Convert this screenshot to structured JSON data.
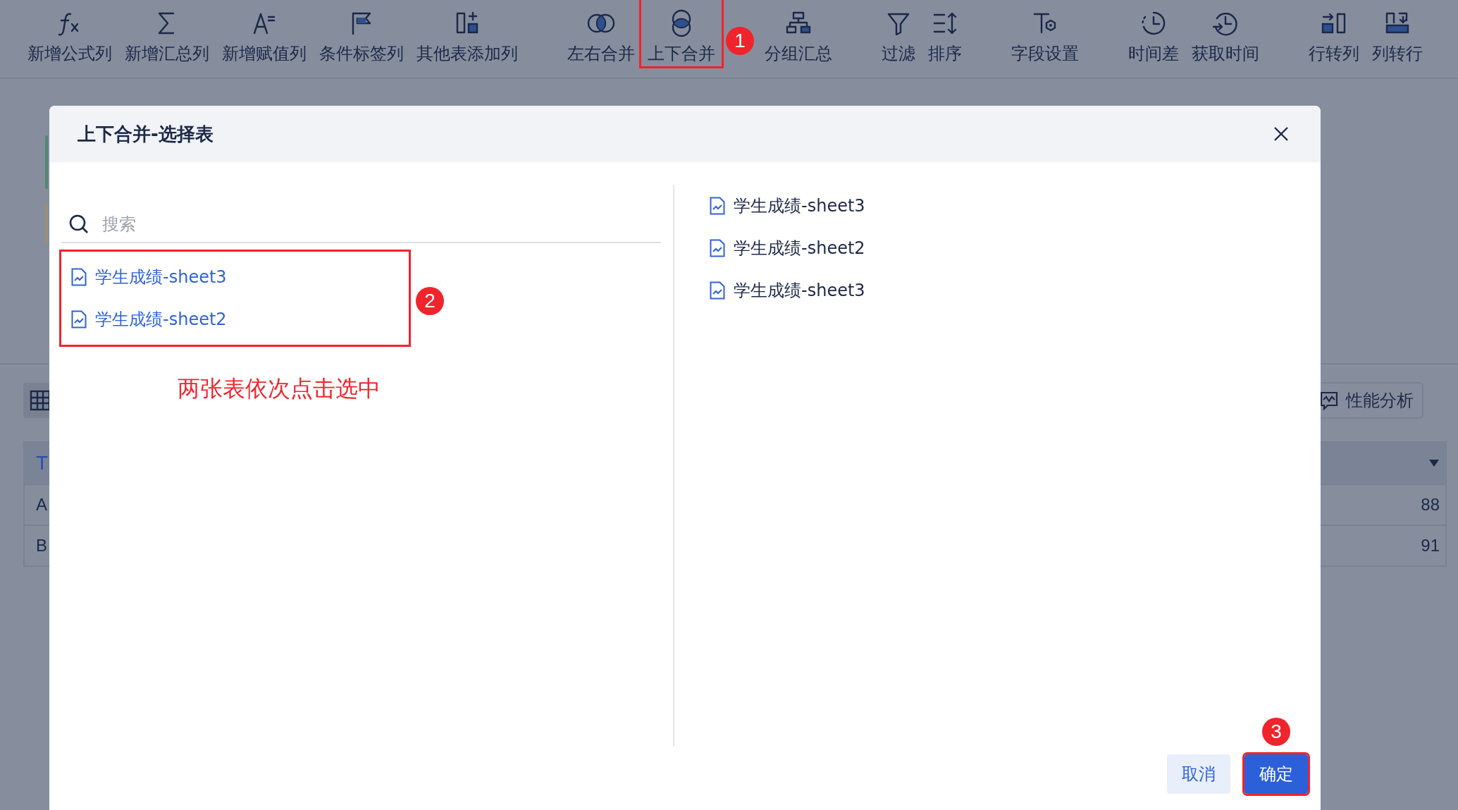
{
  "toolbar": {
    "groups": [
      {
        "items": [
          {
            "label": "新增公式列"
          },
          {
            "label": "新增汇总列"
          },
          {
            "label": "新增赋值列"
          },
          {
            "label": "条件标签列"
          },
          {
            "label": "其他表添加列"
          }
        ]
      },
      {
        "items": [
          {
            "label": "左右合并"
          },
          {
            "label": "上下合并",
            "callout": "1"
          }
        ]
      },
      {
        "items": [
          {
            "label": "分组汇总"
          }
        ]
      },
      {
        "items": [
          {
            "label": "过滤"
          },
          {
            "label": "排序"
          }
        ]
      },
      {
        "items": [
          {
            "label": "字段设置"
          }
        ]
      },
      {
        "items": [
          {
            "label": "时间差"
          },
          {
            "label": "获取时间"
          }
        ]
      },
      {
        "items": [
          {
            "label": "行转列"
          },
          {
            "label": "列转行"
          }
        ]
      }
    ]
  },
  "sheet": {
    "perf_button": "性能分析",
    "header": "T",
    "rows": [
      {
        "label": "A",
        "value": "88"
      },
      {
        "label": "B",
        "value": "91"
      }
    ]
  },
  "dialog": {
    "title": "上下合并-选择表",
    "search": {
      "placeholder": "搜索"
    },
    "source_list": {
      "callout": "2",
      "items": [
        {
          "label": "学生成绩-sheet3",
          "selected": true
        },
        {
          "label": "学生成绩-sheet2",
          "selected": true
        }
      ]
    },
    "note": "两张表依次点击选中",
    "chosen_list": [
      {
        "label": "学生成绩-sheet3"
      },
      {
        "label": "学生成绩-sheet2"
      },
      {
        "label": "学生成绩-sheet3"
      }
    ],
    "buttons": [
      {
        "kind": "secondary",
        "label": "取消"
      },
      {
        "kind": "primary",
        "label": "确定",
        "callout": "3"
      }
    ]
  }
}
